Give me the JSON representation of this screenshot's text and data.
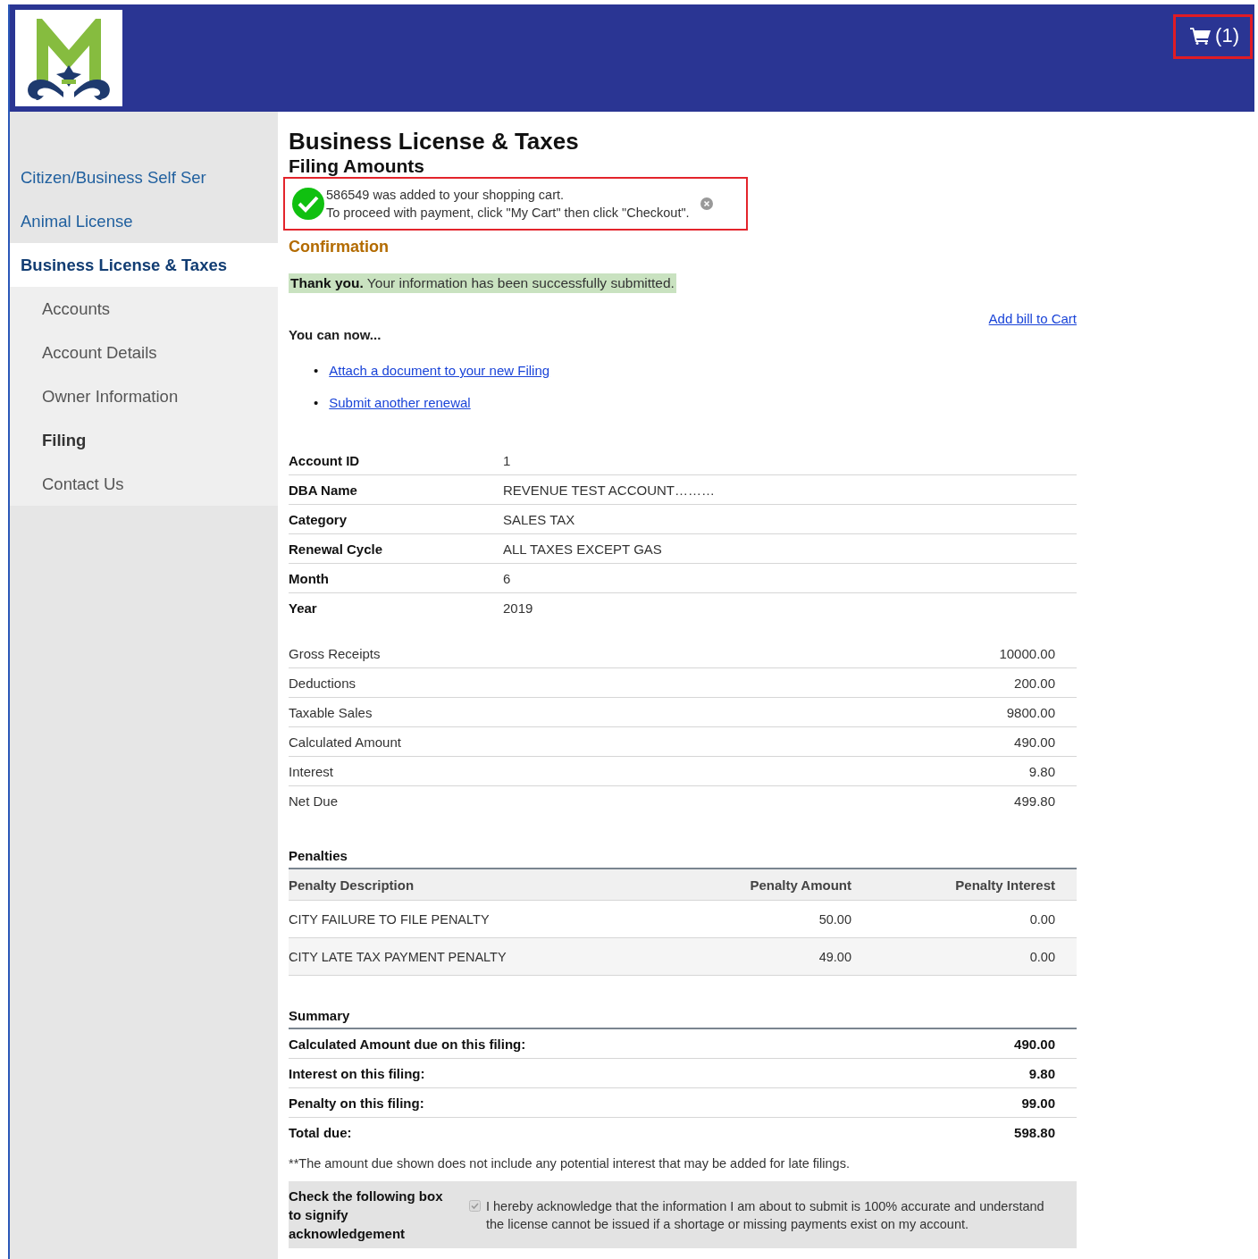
{
  "header": {
    "cart_count": "(1)"
  },
  "sidebar": {
    "items": [
      {
        "label": "Citizen/Business Self Ser",
        "selected": false
      },
      {
        "label": "Animal License",
        "selected": false
      },
      {
        "label": "Business License & Taxes",
        "selected": true,
        "children": [
          {
            "label": "Accounts",
            "selected": false
          },
          {
            "label": "Account Details",
            "selected": false
          },
          {
            "label": "Owner Information",
            "selected": false
          },
          {
            "label": "Filing",
            "selected": true
          },
          {
            "label": "Contact Us",
            "selected": false
          }
        ]
      }
    ]
  },
  "page": {
    "title": "Business License & Taxes",
    "subtitle": "Filing Amounts"
  },
  "notice": {
    "line1": "586549 was added to your shopping cart.",
    "line2": "To proceed with payment, click \"My Cart\" then click \"Checkout\"."
  },
  "confirmation": {
    "heading": "Confirmation",
    "message": "**Thank you.** Your information has been successfully submitted."
  },
  "next_steps": {
    "heading": "You can now...",
    "add_bill_link": "Add bill to Cart",
    "links": [
      {
        "marker": "•",
        "label": "Attach a document to your new Filing"
      },
      {
        "marker": "•",
        "label": "Submit another renewal"
      }
    ]
  },
  "account": [
    {
      "label": "Account ID",
      "value": "1"
    },
    {
      "label": "DBA Name",
      "value": "REVENUE TEST ACCOUNT………"
    },
    {
      "label": "Category",
      "value": "SALES TAX"
    },
    {
      "label": "Renewal Cycle",
      "value": "ALL TAXES EXCEPT GAS"
    },
    {
      "label": "Month",
      "value": "6"
    },
    {
      "label": "Year",
      "value": "2019"
    }
  ],
  "amounts": [
    {
      "label": "Gross Receipts",
      "value": "10000.00"
    },
    {
      "label": "Deductions",
      "value": "200.00"
    },
    {
      "label": "Taxable Sales",
      "value": "9800.00"
    },
    {
      "label": "Calculated Amount",
      "value": "490.00"
    },
    {
      "label": "Interest",
      "value": "9.80"
    },
    {
      "label": "Net Due",
      "value": "499.80"
    }
  ],
  "penalties": {
    "title": "Penalties",
    "columns": [
      "Penalty Description",
      "Penalty Amount",
      "Penalty Interest"
    ],
    "rows": [
      [
        "CITY FAILURE TO FILE PENALTY",
        "50.00",
        "0.00"
      ],
      [
        "CITY LATE TAX PAYMENT PENALTY",
        "49.00",
        "0.00"
      ]
    ]
  },
  "summary": {
    "title": "Summary",
    "rows": [
      {
        "label": "Calculated Amount due on this filing:",
        "value": "490.00"
      },
      {
        "label": "Interest on this filing:",
        "value": "9.80"
      },
      {
        "label": "Penalty on this filing:",
        "value": "99.00"
      },
      {
        "label": "Total due:",
        "value": "598.80"
      }
    ]
  },
  "footnote": "**The amount due shown does not include any potential interest that may be added for late filings.",
  "acknowledgement": {
    "label": "Check the following box to signify acknowledgement",
    "checked": true,
    "disabled": true,
    "text": "I hereby acknowledge that the information I am about to submit is 100% accurate and understand the license cannot be issued if a shortage or missing payments exist on my account."
  }
}
